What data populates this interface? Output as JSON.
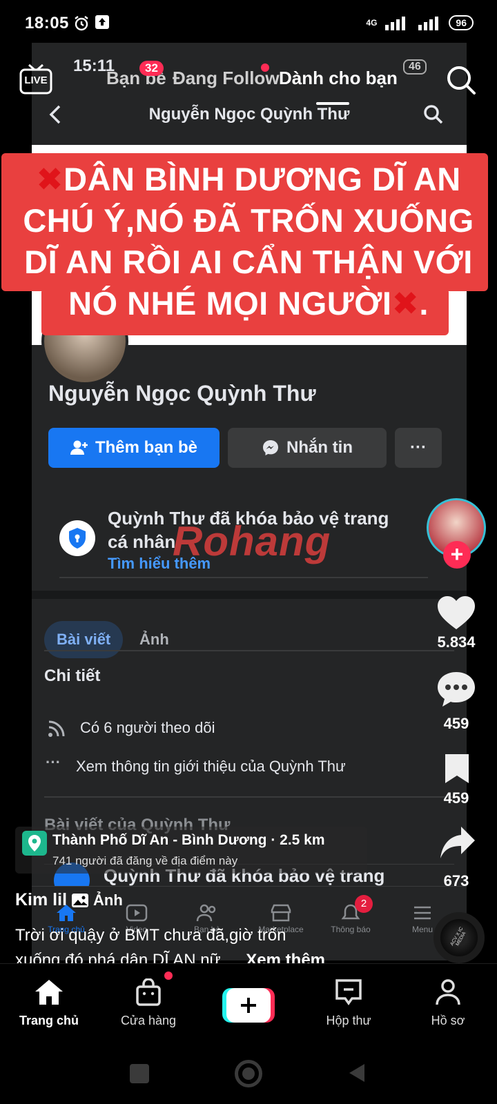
{
  "status_bar": {
    "time": "18:05",
    "network": "4G",
    "battery": "96"
  },
  "top_nav": {
    "live_label": "LIVE",
    "tabs": [
      {
        "label": "Bạn bè",
        "badge": "32"
      },
      {
        "label": "Đang Follow"
      },
      {
        "label": "Dành cho bạn"
      }
    ],
    "inner_time": "15:11",
    "inner_battery": "46"
  },
  "fb_profile": {
    "header_title": "Nguyễn Ngọc Quỳnh Thư",
    "name": "Nguyễn Ngọc Quỳnh Thư",
    "add_friend_label": "Thêm bạn bè",
    "message_label": "Nhắn tin",
    "more_label": "···",
    "locked_text_line1": "Quỳnh Thư đã khóa bảo vệ trang",
    "locked_text_line2": "cá nhân",
    "learn_more": "Tìm hiểu thêm",
    "watermark": "Rohang",
    "tabs": [
      "Bài viết",
      "Ảnh"
    ],
    "details_title": "Chi tiết",
    "followers_text": "Có 6 người theo dõi",
    "intro_text": "Xem thông tin giới thiệu của Quỳnh Thư",
    "posts_header": "Bài viết của Quỳnh Thư",
    "locked_repeat": "Quỳnh Thư đã khóa bảo vệ trang",
    "fb_nav": [
      {
        "label": "Trang chủ"
      },
      {
        "label": "Video"
      },
      {
        "label": "Bạn bè"
      },
      {
        "label": "Marketplace"
      },
      {
        "label": "Thông báo",
        "badge": "2"
      },
      {
        "label": "Menu"
      }
    ]
  },
  "caption_overlay": {
    "lines": [
      "DÂN BÌNH DƯƠNG DĨ AN",
      "CHÚ Ý,NÓ ĐÃ TRỐN XUỐNG",
      "DĨ AN RỒI AI CẨN THẬN VỚI",
      "NÓ NHÉ MỌI NGƯỜI"
    ],
    "line4_suffix": "."
  },
  "right_rail": {
    "likes": "5.834",
    "comments": "459",
    "bookmarks": "459",
    "shares": "673",
    "music_disc_text": "ACV X IC MEDIA"
  },
  "location": {
    "name": "Thành Phố Dĩ An - Bình Dương",
    "distance": "· 2.5 km",
    "sub": "741 người đã đăng về địa điểm này"
  },
  "post": {
    "author": "Kim lil",
    "tag": "Ảnh",
    "caption_line1": "Trời ơi quậy ở BMT chưa đã,giờ trốn",
    "caption_line2": "xuống đó phá dân DĨ AN nữ...",
    "see_more": "Xem thêm"
  },
  "bottom_nav": [
    {
      "label": "Trang chủ",
      "icon": "home-icon"
    },
    {
      "label": "Cửa hàng",
      "icon": "shop-bag-icon"
    },
    {
      "label": "",
      "icon": "plus-icon"
    },
    {
      "label": "Hộp thư",
      "icon": "inbox-icon"
    },
    {
      "label": "Hồ sơ",
      "icon": "profile-icon"
    }
  ],
  "colors": {
    "caption_red": "#e9403f",
    "fb_blue": "#1877f2",
    "like_red": "#fe2c55"
  }
}
